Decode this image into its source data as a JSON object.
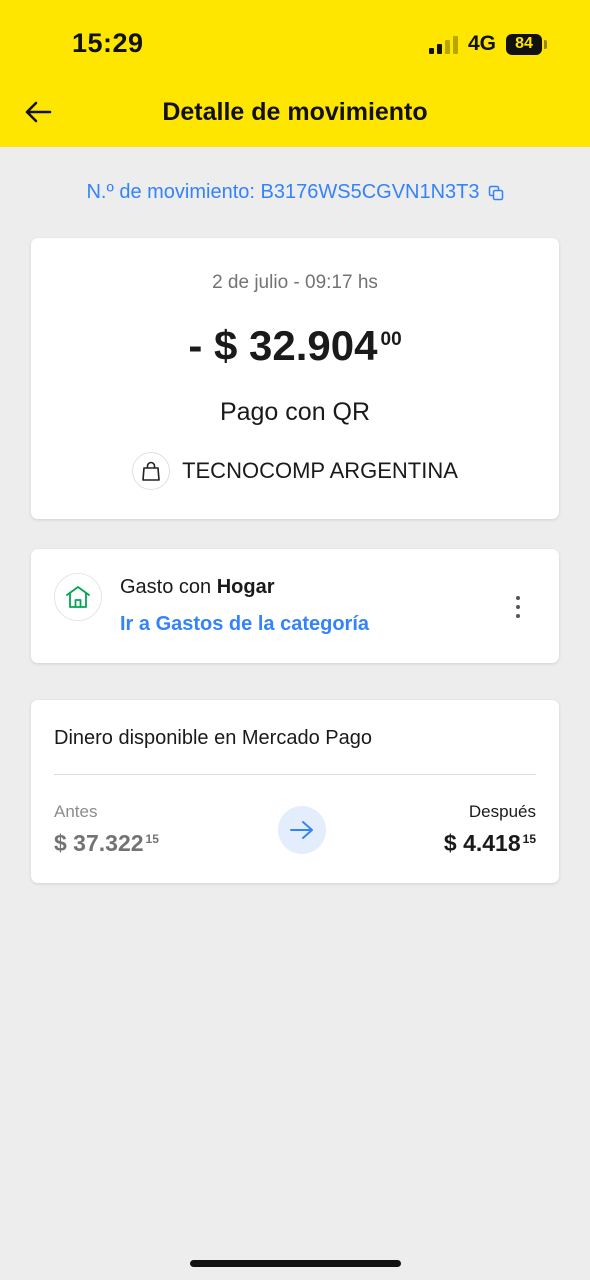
{
  "status_bar": {
    "time": "15:29",
    "network": "4G",
    "battery": "84"
  },
  "header": {
    "title": "Detalle de movimiento"
  },
  "movement": {
    "id_text": "N.º de movimiento: B3176WS5CGVN1N3T3"
  },
  "transaction": {
    "date": "2 de julio - 09:17 hs",
    "amount_main": "- $ 32.904",
    "amount_cents": "00",
    "type": "Pago con QR",
    "merchant": "TECNOCOMP ARGENTINA"
  },
  "category": {
    "prefix": "Gasto con",
    "name": "Hogar",
    "link": "Ir a Gastos de la categoría"
  },
  "balance": {
    "title": "Dinero disponible en Mercado Pago",
    "before_label": "Antes",
    "before_amount": "$ 37.322",
    "before_cents": "15",
    "after_label": "Después",
    "after_amount": "$ 4.418",
    "after_cents": "15"
  },
  "colors": {
    "header_bg": "#ffe600",
    "accent": "#3483fa",
    "category_icon": "#00a650"
  },
  "icons": {
    "back": "arrow-left-icon",
    "copy": "copy-icon",
    "merchant": "shopping-bag-icon",
    "category": "home-category-icon",
    "more": "more-vertical-icon",
    "transfer": "arrow-right-icon"
  }
}
